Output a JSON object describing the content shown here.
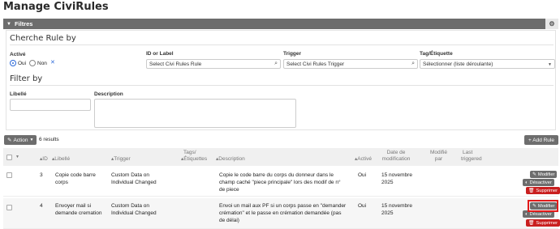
{
  "page": {
    "title": "Manage CiviRules"
  },
  "filters": {
    "bar_label": "Filtres",
    "section_search": "Cherche Rule by",
    "section_filter": "Filter by",
    "active": {
      "label": "Activé",
      "opt_yes": "Oui",
      "opt_no": "Non"
    },
    "id_or_label": {
      "label": "ID or Label",
      "value": "Select Civi Rules Rule"
    },
    "trigger": {
      "label": "Trigger",
      "value": "Select Civi Rules Trigger"
    },
    "tag": {
      "label": "Tag/Étiquette",
      "value": "Sélectionner (liste déroulante)"
    },
    "libelle_label": "Libellé",
    "description_label": "Description"
  },
  "toolbar": {
    "action_label": "Action",
    "results": "6 results",
    "add_rule": "+ Add Rule"
  },
  "table": {
    "headers": {
      "id": "ID",
      "libelle": "Libellé",
      "trigger": "Trigger",
      "tags_line1": "Tags/",
      "tags_line2": "Étiquettes",
      "description": "Description",
      "active": "Activé",
      "date_mod_line1": "Date de",
      "date_mod_line2": "modification",
      "mod_by_line1": "Modifié",
      "mod_by_line2": "par",
      "last_line1": "Last",
      "last_line2": "triggered"
    },
    "rows": [
      {
        "id": "3",
        "libelle_1": "Copie code barre",
        "libelle_2": "corps",
        "trigger_1": "Custom Data on",
        "trigger_2": "Individual Changed",
        "desc_1": "Copie le code barre du corps du donneur dans le",
        "desc_2": "champ caché \"piece principale\" lors des modif de n°",
        "desc_3": "de piece",
        "active": "Oui",
        "date_1": "15 novembre",
        "date_2": "2025",
        "btn_edit": "Modifier",
        "btn_disable": "Désactiver",
        "btn_delete": "Supprimer"
      },
      {
        "id": "4",
        "libelle_1": "Envoyer mail si",
        "libelle_2": "demande cremation",
        "trigger_1": "Custom Data on",
        "trigger_2": "Individual Changed",
        "desc_1": "Envoi un mail aux PF si un corps passe en \"demander",
        "desc_2": "crémation\" et le passe en crémation demandée (pas",
        "desc_3": "de délai)",
        "active": "Oui",
        "date_1": "15 novembre",
        "date_2": "2025",
        "btn_edit": "Modifier",
        "btn_disable": "Désactiver",
        "btn_delete": "Supprimer"
      }
    ]
  }
}
